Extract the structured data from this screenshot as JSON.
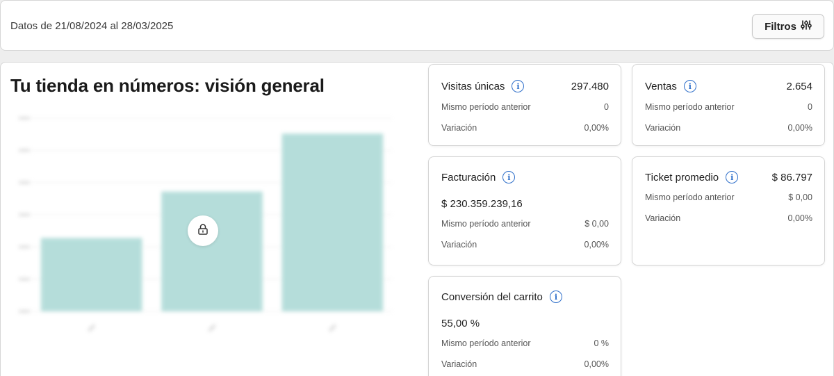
{
  "header": {
    "date_range": "Datos de 21/08/2024 al 28/03/2025",
    "filter_label": "Filtros"
  },
  "main": {
    "title": "Tu tienda en números: visión general"
  },
  "chart_data": {
    "type": "bar",
    "categories": [
      "",
      "",
      ""
    ],
    "values": [
      38,
      62,
      92
    ],
    "ylim": [
      0,
      100
    ],
    "grid": true,
    "bar_color": "#b2dcd9",
    "locked": true
  },
  "cards": {
    "visitas": {
      "title": "Visitas únicas",
      "value": "297.480",
      "prev_label": "Mismo período anterior",
      "prev_value": "0",
      "var_label": "Variación",
      "var_value": "0,00%"
    },
    "ventas": {
      "title": "Ventas",
      "value": "2.654",
      "prev_label": "Mismo período anterior",
      "prev_value": "0",
      "var_label": "Variación",
      "var_value": "0,00%"
    },
    "facturacion": {
      "title": "Facturación",
      "value": "$ 230.359.239,16",
      "prev_label": "Mismo período anterior",
      "prev_value": "$ 0,00",
      "var_label": "Variación",
      "var_value": "0,00%"
    },
    "ticket": {
      "title": "Ticket promedio",
      "value": "$ 86.797",
      "prev_label": "Mismo período anterior",
      "prev_value": "$ 0,00",
      "var_label": "Variación",
      "var_value": "0,00%"
    },
    "conversion": {
      "title": "Conversión del carrito",
      "value": "55,00 %",
      "prev_label": "Mismo período anterior",
      "prev_value": "0 %",
      "var_label": "Variación",
      "var_value": "0,00%"
    }
  },
  "colors": {
    "accent_info": "#2d6ec9",
    "bar": "#b2dcd9"
  }
}
